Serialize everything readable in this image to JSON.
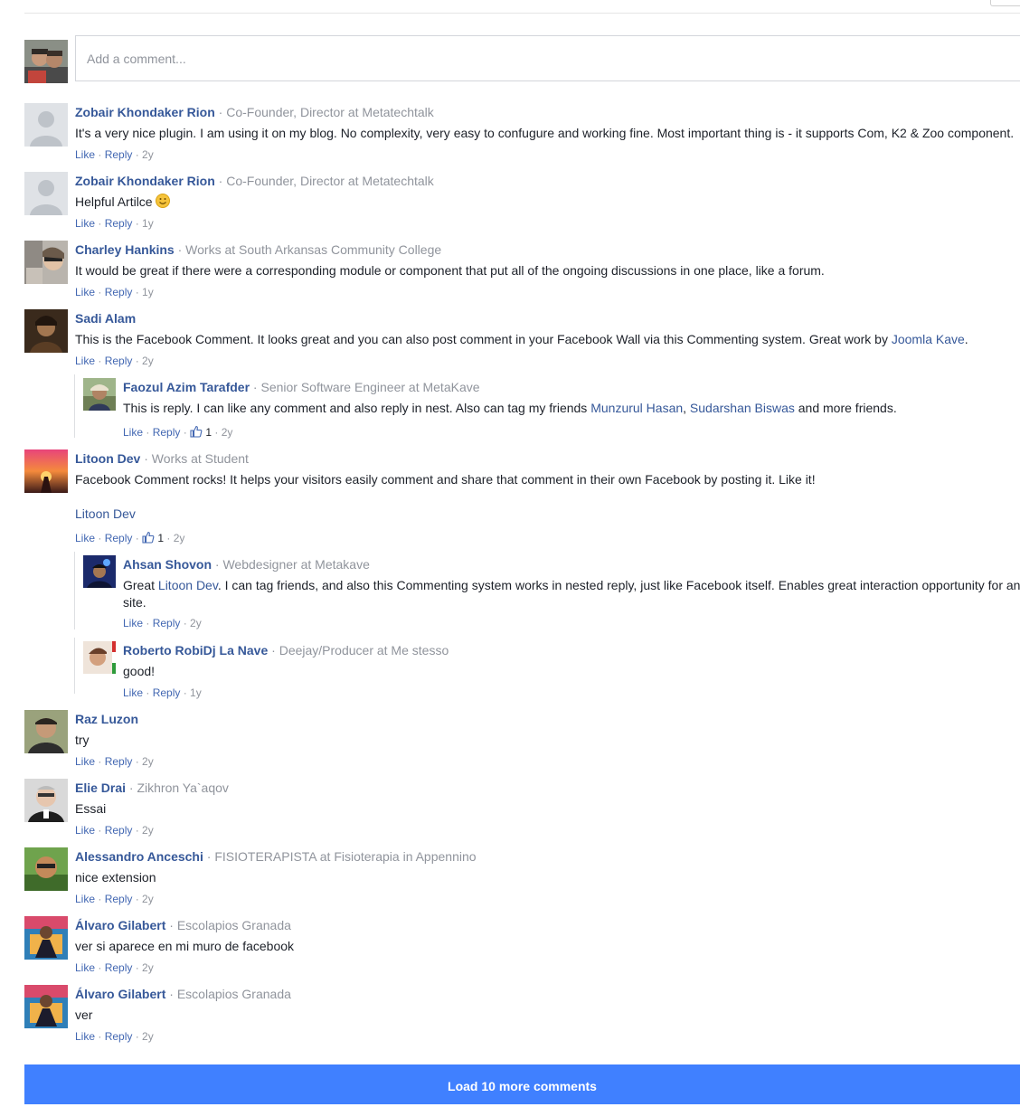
{
  "composer": {
    "placeholder": "Add a comment..."
  },
  "sep": " · ",
  "actions": {
    "like": "Like",
    "reply": "Reply"
  },
  "comments": [
    {
      "name": "Zobair Khondaker Rion",
      "meta": "Co-Founder, Director at Metatechtalk",
      "text": "It's a very nice plugin. I am using it on my blog. No complexity, very easy to confugure and working fine. Most important thing is - it supports Com, K2 & Zoo component.",
      "time": "2y"
    },
    {
      "name": "Zobair Khondaker Rion",
      "meta": "Co-Founder, Director at Metatechtalk",
      "text": "Helpful Artilce",
      "time": "1y"
    },
    {
      "name": "Charley Hankins",
      "meta": "Works at South Arkansas Community College",
      "text": "It would be great if there were a corresponding module or component that put all of the ongoing discussions in one place, like a forum.",
      "time": "1y"
    },
    {
      "name": "Sadi Alam",
      "meta": "",
      "text": "This is the Facebook Comment. It looks great and you can also post comment in your Facebook Wall via this Commenting system. Great work by ",
      "link": "Joomla Kave",
      "text_end": ".",
      "time": "2y",
      "replies": [
        {
          "name": "Faozul Azim Tarafder",
          "meta": "Senior Software Engineer at MetaKave",
          "text": "This is reply. I can like any comment and also reply in nest. Also can tag my friends ",
          "tag1": "Munzurul Hasan",
          "mid": ", ",
          "tag2": "Sudarshan Biswas",
          "text_end": " and more friends.",
          "likes": "1",
          "time": "2y"
        }
      ]
    },
    {
      "name": "Litoon Dev",
      "meta": "Works at Student",
      "text": "Facebook Comment rocks! It helps your visitors easily comment and share that comment in their own Facebook by posting it. Like it!",
      "signature": "Litoon Dev",
      "likes": "1",
      "time": "2y",
      "replies": [
        {
          "name": "Ahsan Shovon",
          "meta": "Webdesigner at Metakave",
          "text_pre": "Great ",
          "tag": "Litoon Dev",
          "text": ". I can tag friends, and also this Commenting system works in nested reply, just like Facebook itself. Enables great interaction opportunity for any site.",
          "time": "2y"
        },
        {
          "name": "Roberto RobiDj La Nave",
          "meta": "Deejay/Producer at Me stesso",
          "text": "good!",
          "time": "1y"
        }
      ]
    },
    {
      "name": "Raz Luzon",
      "meta": "",
      "text": "try",
      "time": "2y"
    },
    {
      "name": "Elie Drai",
      "meta": "Zikhron Ya`aqov",
      "text": "Essai",
      "time": "2y"
    },
    {
      "name": "Alessandro Anceschi",
      "meta": "FISIOTERAPISTA at Fisioterapia in Appennino",
      "text": "nice extension",
      "time": "2y"
    },
    {
      "name": "Álvaro Gilabert",
      "meta": "Escolapios Granada",
      "text": "ver si aparece en mi muro de facebook",
      "time": "2y"
    },
    {
      "name": "Álvaro Gilabert",
      "meta": "Escolapios Granada",
      "text": "ver",
      "time": "2y"
    }
  ],
  "load_more": "Load 10 more comments"
}
